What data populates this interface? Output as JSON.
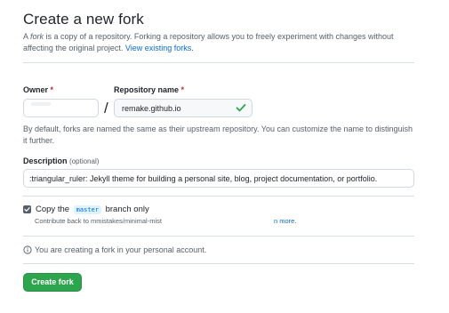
{
  "page": {
    "title": "Create a new fork",
    "intro_prefix": "A ",
    "intro_em": "fork",
    "intro_suffix": " is a copy of a repository. Forking a repository allows you to freely experiment with changes without affecting the original project.",
    "view_forks_link": "View existing forks."
  },
  "owner": {
    "label": "Owner",
    "required_mark": "*",
    "value": ""
  },
  "repository": {
    "label": "Repository name",
    "required_mark": "*",
    "value": "remake.github.io",
    "valid": true
  },
  "separator": "/",
  "help_text": "By default, forks are named the same as their upstream repository. You can customize the name to distinguish it further.",
  "description": {
    "label": "Description",
    "optional": "(optional)",
    "value": ":triangular_ruler: Jekyll theme for building a personal site, blog, project documentation, or portfolio."
  },
  "copy_branch": {
    "checked": true,
    "label_prefix": "Copy the",
    "branch": "master",
    "label_suffix": "branch only",
    "contrib_text": "Contribute back to mmistakes/minimal-mist",
    "learn_more": "n more."
  },
  "info": {
    "text": "You are creating a fork in your personal account."
  },
  "submit": {
    "label": "Create fork"
  },
  "colors": {
    "primary_button": "#2da44e",
    "link": "#0969da",
    "required": "#cf222e",
    "check": "#2da44e"
  },
  "icons": {
    "repo_valid": "check-icon",
    "info": "info-icon",
    "checkbox": "checkbox-checked-icon"
  }
}
